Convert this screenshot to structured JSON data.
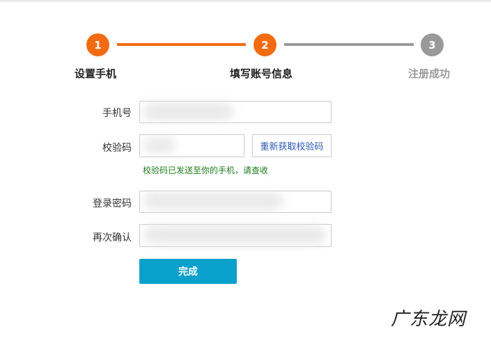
{
  "steps": [
    {
      "number": "1",
      "label": "设置手机"
    },
    {
      "number": "2",
      "label": "填写账号信息"
    },
    {
      "number": "3",
      "label": "注册成功"
    }
  ],
  "form": {
    "phone_label": "手机号",
    "code_label": "校验码",
    "resend_button": "重新获取校验码",
    "code_hint": "校验码已发送至你的手机，请查收",
    "password_label": "登录密码",
    "confirm_label": "再次确认",
    "submit_button": "完成"
  },
  "watermark": "广东龙网",
  "colors": {
    "active": "#f26b12",
    "inactive": "#999999",
    "primary": "#0aa0cc",
    "hint": "#1b7d1b"
  }
}
